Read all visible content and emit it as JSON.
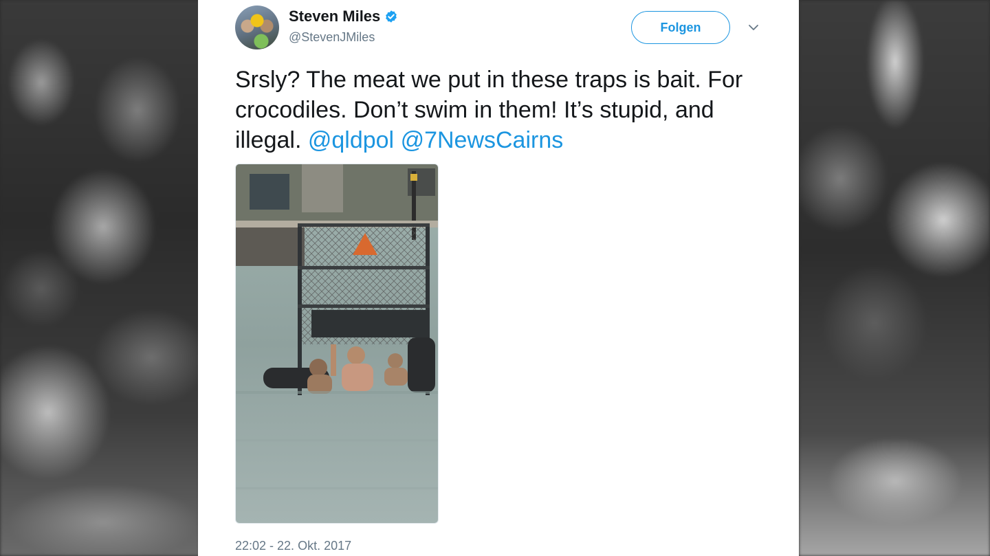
{
  "author": {
    "display_name": "Steven Miles",
    "handle": "@StevenJMiles",
    "verified": true
  },
  "follow_button": {
    "label": "Folgen"
  },
  "tweet": {
    "text_segments": [
      "Srsly? The meat we put in these traps is bait. For crocodiles. Don’t swim in them! It’s stupid, and illegal. "
    ],
    "mentions": [
      "@qldpol",
      "@7NewsCairns"
    ],
    "timestamp": "22:02 - 22. Okt. 2017"
  },
  "icons": {
    "verified": "verified-badge-icon",
    "caret": "chevron-down-icon"
  },
  "colors": {
    "link": "#1b95e0",
    "text": "#14171a",
    "secondary": "#657786",
    "verified": "#1da1f2"
  }
}
